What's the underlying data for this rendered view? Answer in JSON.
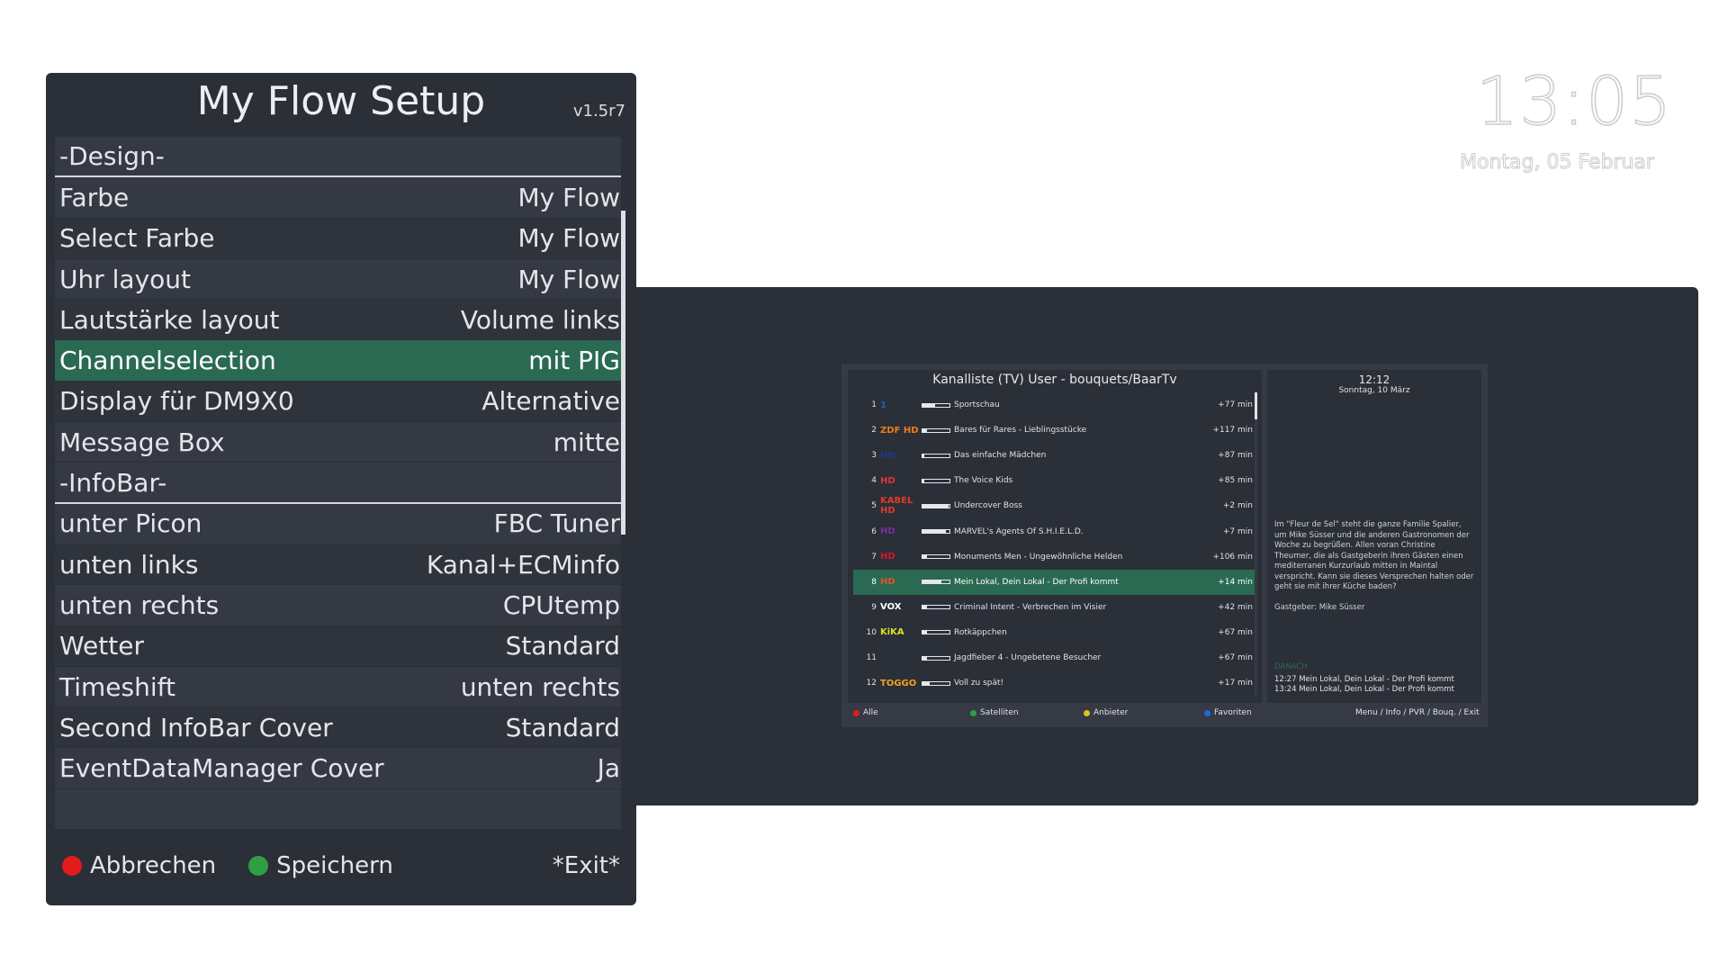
{
  "setup": {
    "title": "My Flow Setup",
    "version": "v1.5r7",
    "rows": [
      {
        "type": "section",
        "label": "-Design-",
        "value": ""
      },
      {
        "type": "item",
        "label": "Farbe",
        "value": "My Flow"
      },
      {
        "type": "item",
        "label": "Select Farbe",
        "value": "My Flow"
      },
      {
        "type": "item",
        "label": "Uhr layout",
        "value": "My Flow"
      },
      {
        "type": "item",
        "label": "Lautstärke layout",
        "value": "Volume links"
      },
      {
        "type": "item",
        "label": "Channelselection",
        "value": "mit PIG",
        "selected": true
      },
      {
        "type": "item",
        "label": "Display für DM9X0",
        "value": "Alternative"
      },
      {
        "type": "item",
        "label": "Message Box",
        "value": "mitte"
      },
      {
        "type": "section",
        "label": "-InfoBar-",
        "value": ""
      },
      {
        "type": "item",
        "label": "unter Picon",
        "value": "FBC Tuner"
      },
      {
        "type": "item",
        "label": "unten links",
        "value": "Kanal+ECMinfo"
      },
      {
        "type": "item",
        "label": "unten rechts",
        "value": "CPUtemp"
      },
      {
        "type": "item",
        "label": "Wetter",
        "value": "Standard"
      },
      {
        "type": "item",
        "label": "Timeshift",
        "value": "unten rechts"
      },
      {
        "type": "item",
        "label": "Second InfoBar Cover",
        "value": "Standard"
      },
      {
        "type": "item",
        "label": "EventDataManager Cover",
        "value": "Ja"
      },
      {
        "type": "blank",
        "label": "",
        "value": ""
      }
    ],
    "footer": {
      "cancel_label": "Abbrechen",
      "save_label": "Speichern",
      "exit_label": "*Exit*",
      "cancel_color": "#e21b1b",
      "save_color": "#2ea043"
    }
  },
  "clock": {
    "time": "13:05",
    "date": "Montag, 05 Februar"
  },
  "preview": {
    "header": "Kanalliste (TV) User - bouquets/BaarTv",
    "channels": [
      {
        "num": "1",
        "logo": "1",
        "logo_color": "#1f63b8",
        "progress": 0.45,
        "title": "Sportschau",
        "remaining": "+77 min"
      },
      {
        "num": "2",
        "logo": "ZDF HD",
        "logo_color": "#f07d1a",
        "progress": 0.15,
        "title": "Bares für Rares - Lieblingsstücke",
        "remaining": "+117 min"
      },
      {
        "num": "3",
        "logo": "HD",
        "logo_color": "#1a3c8a",
        "progress": 0.05,
        "title": "Das einfache Mädchen",
        "remaining": "+87 min"
      },
      {
        "num": "4",
        "logo": "HD",
        "logo_color": "#e3362c",
        "progress": 0.05,
        "title": "The Voice Kids",
        "remaining": "+85 min"
      },
      {
        "num": "5",
        "logo": "KABEL HD",
        "logo_color": "#e03a2a",
        "progress": 0.95,
        "title": "Undercover Boss",
        "remaining": "+2 min"
      },
      {
        "num": "6",
        "logo": "HD",
        "logo_color": "#7b2fa0",
        "progress": 0.85,
        "title": "MARVEL's Agents Of S.H.I.E.L.D.",
        "remaining": "+7 min"
      },
      {
        "num": "7",
        "logo": "HD",
        "logo_color": "#d8182a",
        "progress": 0.15,
        "title": "Monuments Men - Ungewöhnliche Helden",
        "remaining": "+106 min"
      },
      {
        "num": "8",
        "logo": "HD",
        "logo_color": "#e4532a",
        "progress": 0.7,
        "title": "Mein Lokal, Dein Lokal - Der Profi kommt",
        "remaining": "+14 min",
        "selected": true
      },
      {
        "num": "9",
        "logo": "VOX",
        "logo_color": "#ffffff",
        "progress": 0.15,
        "title": "Criminal Intent - Verbrechen im Visier",
        "remaining": "+42 min"
      },
      {
        "num": "10",
        "logo": "KiKA",
        "logo_color": "#d8e020",
        "progress": 0.15,
        "title": "Rotkäppchen",
        "remaining": "+67 min"
      },
      {
        "num": "11",
        "logo": "",
        "logo_color": "#e0342a",
        "progress": 0.15,
        "title": "Jagdfieber 4 - Ungebetene Besucher",
        "remaining": "+67 min"
      },
      {
        "num": "12",
        "logo": "TOGGO",
        "logo_color": "#f2a31b",
        "progress": 0.25,
        "title": "Voll zu spät!",
        "remaining": "+17 min"
      }
    ],
    "side": {
      "time": "12:12",
      "date": "Sonntag, 10 März",
      "description": "Im \"Fleur de Sel\" steht die ganze Familie Spalier, um Mike Süsser und die anderen Gastronomen der Woche zu begrüßen. Allen voran Christine Theumer, die als Gastgeberin ihren Gästen einen mediterranen Kurzurlaub mitten in Maintal verspricht. Kann sie dieses Versprechen halten oder geht sie mit ihrer Küche baden?",
      "host": "Gastgeber: Mike Süsser",
      "next_label": "DANACH",
      "next": [
        "12:27   Mein Lokal, Dein Lokal - Der Profi kommt",
        "13:24   Mein Lokal, Dein Lokal - Der Profi kommt"
      ]
    },
    "footer": [
      {
        "label": "Alle",
        "color": "#e21b1b"
      },
      {
        "label": "Satelliten",
        "color": "#2ea043"
      },
      {
        "label": "Anbieter",
        "color": "#e2c01b"
      },
      {
        "label": "Favoriten",
        "color": "#1b6ae2"
      },
      {
        "label": "Menu / Info / PVR / Bouq. / Exit",
        "color": ""
      }
    ]
  }
}
